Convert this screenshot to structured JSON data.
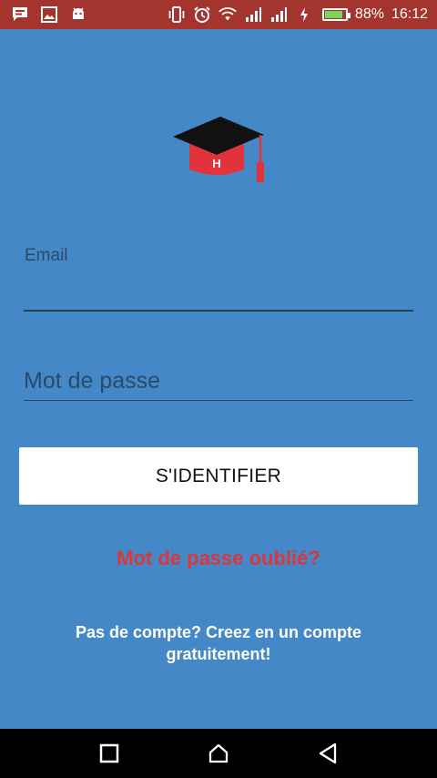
{
  "status_bar": {
    "battery_percent": 88,
    "battery_label": "88%",
    "time": "16:12",
    "left_icons": [
      "message-icon",
      "image-icon",
      "android-icon"
    ],
    "right_icons": [
      "vibrate-icon",
      "alarm-icon",
      "wifi-icon",
      "signal-icon",
      "signal-icon",
      "charging-icon",
      "battery-icon"
    ],
    "background_color": "#a3342e"
  },
  "app": {
    "background_color": "#4488c8",
    "logo": {
      "icon": "graduation-cap-icon",
      "letter": "H",
      "cap_color": "#111111",
      "band_color": "#e0343a"
    },
    "email": {
      "label": "Email",
      "value": "",
      "placeholder": ""
    },
    "password": {
      "value": "",
      "placeholder": "Mot de passe"
    },
    "signin_label": "S'IDENTIFIER",
    "forgot_label": "Mot de passe oublié?",
    "forgot_color": "#d9383b",
    "signup_label": "Pas de compte? Creez en un compte gratuitement!"
  },
  "nav_bar": {
    "buttons": [
      "recents-icon",
      "home-icon",
      "back-icon"
    ]
  }
}
